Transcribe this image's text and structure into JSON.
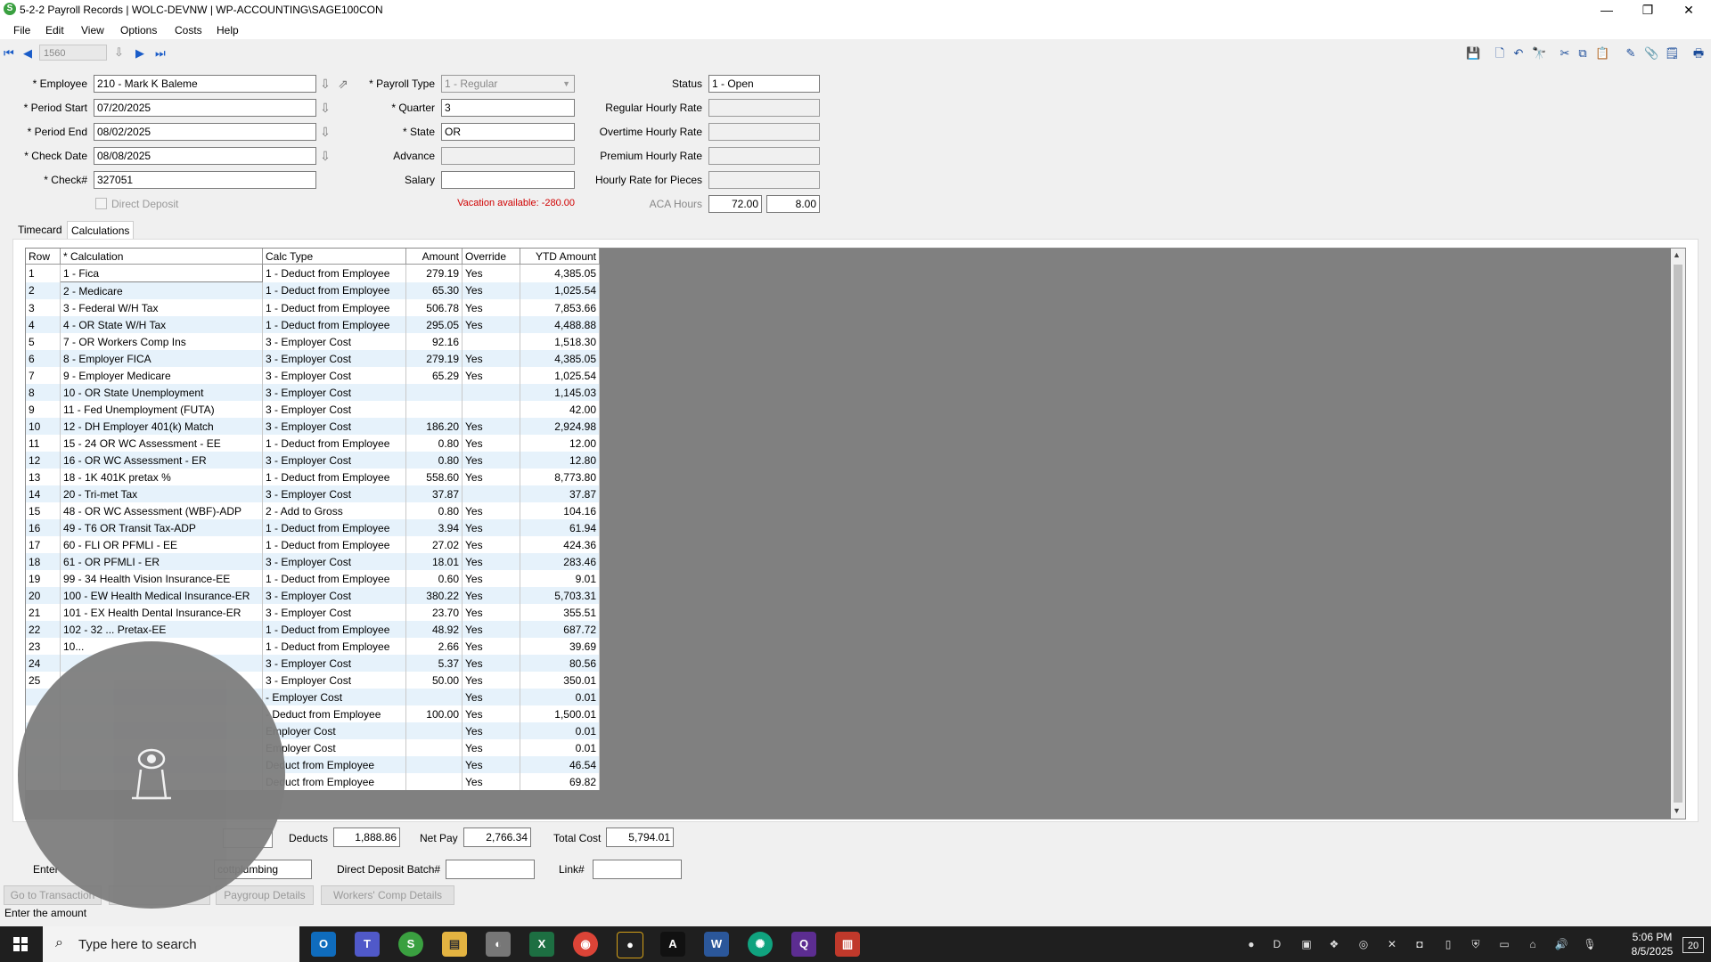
{
  "window": {
    "title": "5-2-2 Payroll Records | WOLC-DEVNW | WP-ACCOUNTING\\SAGE100CON",
    "minimize": "—",
    "restore": "❐",
    "close": "✕"
  },
  "menu": [
    "File",
    "Edit",
    "View",
    "Options",
    "Costs",
    "Help"
  ],
  "toolbar": {
    "record_number": "1560"
  },
  "form": {
    "employee_label": "* Employee",
    "employee_value": "210 - Mark K Baleme",
    "period_start_label": "* Period Start",
    "period_start_value": "07/20/2025",
    "period_end_label": "* Period End",
    "period_end_value": "08/02/2025",
    "check_date_label": "* Check Date",
    "check_date_value": "08/08/2025",
    "check_label": "* Check#",
    "check_value": "327051",
    "direct_deposit_label": "Direct Deposit",
    "payroll_type_label": "* Payroll Type",
    "payroll_type_value": "1 - Regular",
    "quarter_label": "* Quarter",
    "quarter_value": "3",
    "state_label": "* State",
    "state_value": "OR",
    "advance_label": "Advance",
    "advance_value": "",
    "salary_label": "Salary",
    "salary_value": "",
    "vacation_text": "Vacation available:  -280.00",
    "status_label": "Status",
    "status_value": "1 - Open",
    "regular_rate_label": "Regular Hourly Rate",
    "overtime_rate_label": "Overtime Hourly Rate",
    "premium_rate_label": "Premium Hourly Rate",
    "pieces_rate_label": "Hourly Rate for Pieces",
    "aca_label": "ACA Hours",
    "aca_value1": "72.00",
    "aca_value2": "8.00"
  },
  "tabs": [
    "Timecard",
    "Calculations"
  ],
  "grid": {
    "headers": [
      "Row",
      "* Calculation",
      "Calc Type",
      "Amount",
      "Override",
      "YTD Amount"
    ],
    "rows": [
      [
        "1",
        "1 - Fica",
        "1 - Deduct from Employee",
        "279.19",
        "Yes",
        "4,385.05"
      ],
      [
        "2",
        "2 - Medicare",
        "1 - Deduct from Employee",
        "65.30",
        "Yes",
        "1,025.54"
      ],
      [
        "3",
        "3 - Federal W/H Tax",
        "1 - Deduct from Employee",
        "506.78",
        "Yes",
        "7,853.66"
      ],
      [
        "4",
        "4 - OR State W/H Tax",
        "1 - Deduct from Employee",
        "295.05",
        "Yes",
        "4,488.88"
      ],
      [
        "5",
        "7 - OR Workers Comp Ins",
        "3 - Employer Cost",
        "92.16",
        "",
        "1,518.30"
      ],
      [
        "6",
        "8 - Employer FICA",
        "3 - Employer Cost",
        "279.19",
        "Yes",
        "4,385.05"
      ],
      [
        "7",
        "9 - Employer Medicare",
        "3 - Employer Cost",
        "65.29",
        "Yes",
        "1,025.54"
      ],
      [
        "8",
        "10 - OR State Unemployment",
        "3 - Employer Cost",
        "",
        "",
        "1,145.03"
      ],
      [
        "9",
        "11 - Fed Unemployment (FUTA)",
        "3 - Employer Cost",
        "",
        "",
        "42.00"
      ],
      [
        "10",
        "12 - DH Employer 401(k) Match",
        "3 - Employer Cost",
        "186.20",
        "Yes",
        "2,924.98"
      ],
      [
        "11",
        "15 - 24 OR WC Assessment - EE",
        "1 - Deduct from Employee",
        "0.80",
        "Yes",
        "12.00"
      ],
      [
        "12",
        "16 - OR WC Assessment - ER",
        "3 - Employer Cost",
        "0.80",
        "Yes",
        "12.80"
      ],
      [
        "13",
        "18 - 1K 401K pretax %",
        "1 - Deduct from Employee",
        "558.60",
        "Yes",
        "8,773.80"
      ],
      [
        "14",
        "20 - Tri-met Tax",
        "3 - Employer Cost",
        "37.87",
        "",
        "37.87"
      ],
      [
        "15",
        "48 - OR WC Assessment (WBF)-ADP",
        "2 - Add to Gross",
        "0.80",
        "Yes",
        "104.16"
      ],
      [
        "16",
        "49 - T6 OR Transit Tax-ADP",
        "1 - Deduct from Employee",
        "3.94",
        "Yes",
        "61.94"
      ],
      [
        "17",
        "60 - FLI OR PFMLI - EE",
        "1 - Deduct from Employee",
        "27.02",
        "Yes",
        "424.36"
      ],
      [
        "18",
        "61 - OR PFMLI - ER",
        "3 - Employer Cost",
        "18.01",
        "Yes",
        "283.46"
      ],
      [
        "19",
        "99 - 34 Health Vision Insurance-EE",
        "1 - Deduct from Employee",
        "0.60",
        "Yes",
        "9.01"
      ],
      [
        "20",
        "100 - EW Health Medical Insurance-ER",
        "3 - Employer Cost",
        "380.22",
        "Yes",
        "5,703.31"
      ],
      [
        "21",
        "101 - EX Health Dental Insurance-ER",
        "3 - Employer Cost",
        "23.70",
        "Yes",
        "355.51"
      ],
      [
        "22",
        "102 - 32 ... Pretax-EE",
        "1 - Deduct from Employee",
        "48.92",
        "Yes",
        "687.72"
      ],
      [
        "23",
        "10...",
        "1 - Deduct from Employee",
        "2.66",
        "Yes",
        "39.69"
      ],
      [
        "24",
        "",
        "3 - Employer Cost",
        "5.37",
        "Yes",
        "80.56"
      ],
      [
        "25",
        "",
        "3 - Employer Cost",
        "50.00",
        "Yes",
        "350.01"
      ],
      [
        "",
        "",
        "- Employer Cost",
        "",
        "Yes",
        "0.01"
      ],
      [
        "",
        "",
        "- Deduct from Employee",
        "100.00",
        "Yes",
        "1,500.01"
      ],
      [
        "",
        "",
        "Employer Cost",
        "",
        "Yes",
        "0.01"
      ],
      [
        "",
        "",
        "Employer Cost",
        "",
        "Yes",
        "0.01"
      ],
      [
        "",
        "",
        "Deduct from Employee",
        "",
        "Yes",
        "46.54"
      ],
      [
        "",
        "",
        "Deduct from Employee",
        "",
        "Yes",
        "69.82"
      ]
    ]
  },
  "summary": {
    "deducts_label": "Deducts",
    "deducts_value": "1,888.86",
    "netpay_label": "Net Pay",
    "netpay_value": "2,766.34",
    "totalcost_label": "Total Cost",
    "totalcost_value": "5,794.01"
  },
  "footer": {
    "entered_label": "Enter",
    "entered_value": "cottplumbing",
    "ddbatch_label": "Direct Deposit Batch#",
    "link_label": "Link#",
    "btn_goto": "Go to Transaction",
    "btn_paygroup": "Paygroup Details",
    "btn_workers": "Workers' Comp Details"
  },
  "status_text": "Enter the amount",
  "taskbar": {
    "search_placeholder": "Type here to search",
    "time": "5:06 PM",
    "date": "8/5/2025",
    "notifications": "20"
  },
  "colors": {
    "accent": "#1a5cc8",
    "row_alt": "#e6f2fb",
    "vacation": "#d00000",
    "grid_bg": "#808080"
  }
}
